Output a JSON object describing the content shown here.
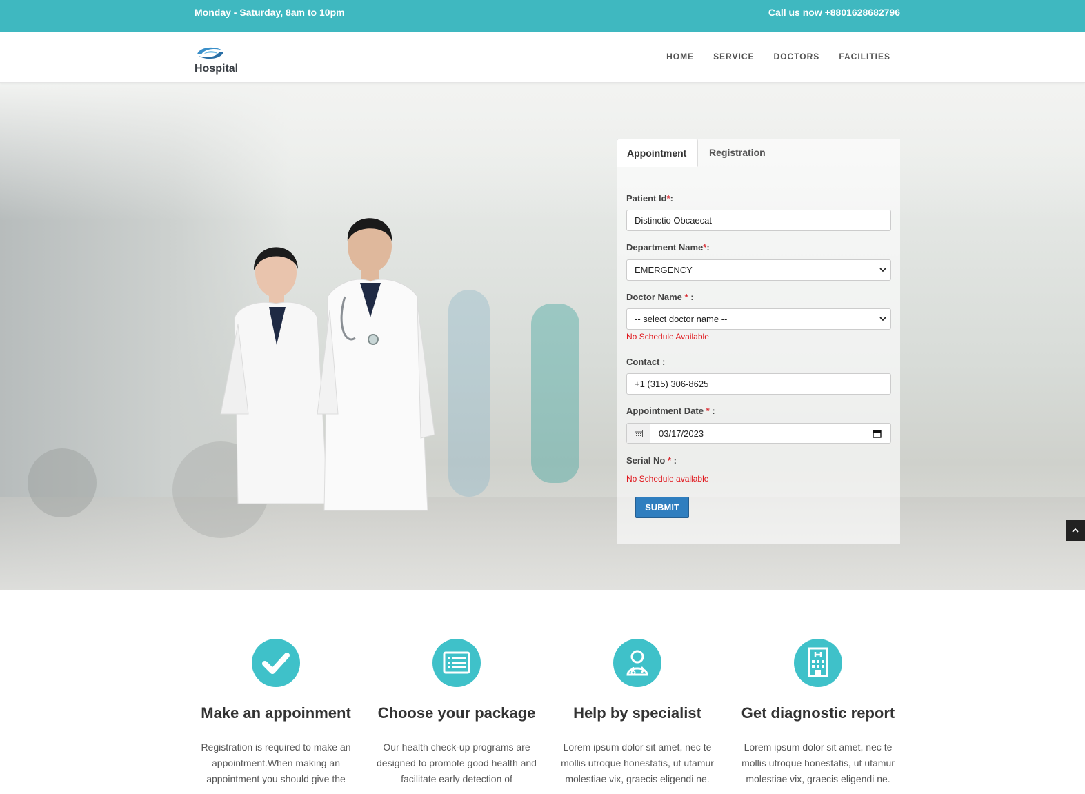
{
  "topbar": {
    "hours": "Monday - Saturday, 8am to 10pm",
    "phone": "Call us now +8801628682796"
  },
  "brand": {
    "name": "Hospital"
  },
  "nav": [
    "HOME",
    "SERVICE",
    "DOCTORS",
    "FACILITIES"
  ],
  "form": {
    "tabs": [
      "Appointment",
      "Registration"
    ],
    "active_tab": "Appointment",
    "patient_id": {
      "label": "Patient Id",
      "value": "Distinctio Obcaecat"
    },
    "department": {
      "label": "Department Name",
      "value": "EMERGENCY"
    },
    "doctor": {
      "label": "Doctor Name ",
      "value": "-- select doctor name --",
      "note": "No Schedule Available"
    },
    "contact": {
      "label": "Contact :",
      "value": "+1 (315) 306-8625"
    },
    "date": {
      "label": "Appointment Date ",
      "value": "03/17/2023"
    },
    "serial": {
      "label": "Serial No ",
      "note": "No Schedule available"
    },
    "submit_label": "SUBMIT"
  },
  "features": [
    {
      "icon": "check-icon",
      "title": "Make an appoinment",
      "text": "Registration is required to make an appointment.When making an appointment you should give the"
    },
    {
      "icon": "list-card-icon",
      "title": "Choose your package",
      "text": "Our health check-up programs are designed to promote good health and facilitate early detection of"
    },
    {
      "icon": "doctor-icon",
      "title": "Help by specialist",
      "text": "Lorem ipsum dolor sit amet, nec te mollis utroque honestatis, ut utamur molestiae vix, graecis eligendi ne."
    },
    {
      "icon": "hospital-building-icon",
      "title": "Get diagnostic report",
      "text": "Lorem ipsum dolor sit amet, nec te mollis utroque honestatis, ut utamur molestiae vix, graecis eligendi ne."
    }
  ],
  "colors": {
    "accent": "#3fb8c0",
    "button": "#2f7ebf",
    "error": "#e0141a"
  }
}
